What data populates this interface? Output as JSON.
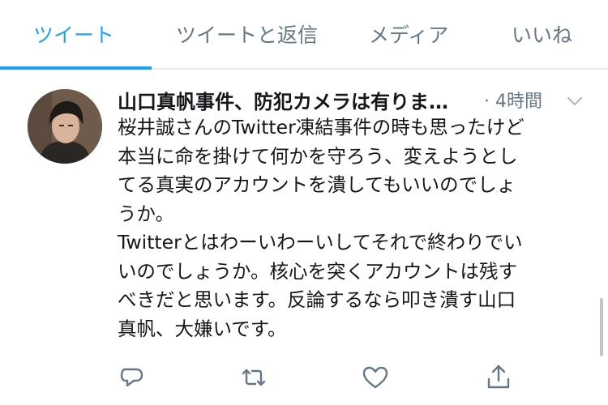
{
  "tabs": [
    {
      "label": "ツイート",
      "active": true
    },
    {
      "label": "ツイートと返信",
      "active": false
    },
    {
      "label": "メディア",
      "active": false
    },
    {
      "label": "いいね",
      "active": false
    }
  ],
  "tweet": {
    "author_name": "山口真帆事件、防犯カメラは有りま…",
    "time": "· 4時間",
    "lines": [
      "桜井誠さんのTwitter凍結事件の時も思ったけど",
      "本当に命を掛けて何かを守ろう、変えようとし",
      "てる真実のアカウントを潰してもいいのでしょ",
      "うか。",
      "Twitterとはわーいわーいしてそれで終わりでい",
      "いのでしょうか。核心を突くアカウントは残す",
      "べきだと思います。反論するなら叩き潰す山口",
      "真帆、大嫌いです。"
    ]
  },
  "icons": {
    "menu": "chevron-down-icon",
    "reply": "reply-icon",
    "retweet": "retweet-icon",
    "like": "heart-icon",
    "share": "share-icon"
  },
  "colors": {
    "accent": "#1da1f2",
    "secondary_text": "#657786",
    "primary_text": "#14171a",
    "divider": "#e6ecf0"
  }
}
